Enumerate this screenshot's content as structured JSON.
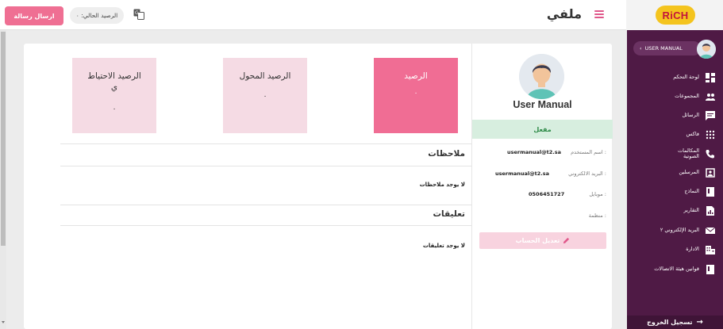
{
  "topbar": {
    "send_button": "ارسال رسالة",
    "balance_label": "الرصيد الحالي: ٠",
    "page_title": "ملفي",
    "logo_text": "RiCH"
  },
  "sidebar": {
    "user_label": "USER MANUAL",
    "items": [
      {
        "label": "لوحة التحكم",
        "icon": "dashboard-icon"
      },
      {
        "label": "المجموعات",
        "icon": "groups-icon"
      },
      {
        "label": "الرسائل",
        "icon": "messages-icon"
      },
      {
        "label": "فاكس",
        "icon": "fax-icon"
      },
      {
        "label": "المكالمات الصوتية",
        "icon": "phone-icon"
      },
      {
        "label": "المرسلين",
        "icon": "senders-icon"
      },
      {
        "label": "النماذج",
        "icon": "templates-icon"
      },
      {
        "label": "التقارير",
        "icon": "reports-icon"
      },
      {
        "label": "البريد الإلكتروني ٢",
        "icon": "mail-icon"
      },
      {
        "label": "الادارة",
        "icon": "admin-icon"
      },
      {
        "label": "قوانين هيئة الاتصالات",
        "icon": "rules-icon"
      }
    ],
    "logout_label": "تسجيل الخروج"
  },
  "profile": {
    "name": "User Manual",
    "status": "مفعل",
    "username_label": "اسم المستخدم :",
    "username_value": "usermanual@t2.sa",
    "email_label": "البريد الالكتروني :",
    "email_value": "usermanual@t2.sa",
    "mobile_label": "موبايل :",
    "mobile_value": "0506451727",
    "org_label": "منظمة :",
    "edit_button": "تعديل الحساب"
  },
  "stats": [
    {
      "title": "الرصيد",
      "value": "٠"
    },
    {
      "title": "الرصيد المحول",
      "value": "٠"
    },
    {
      "title_line1": "الرصيد الاحتياط",
      "title_line2": "ي",
      "value": "٠"
    }
  ],
  "notes": {
    "heading": "ملاحظات",
    "empty": "لا يوجد ملاحظات"
  },
  "comments": {
    "heading": "تعليقات",
    "empty": "لا يوجد تعليقات"
  },
  "colors": {
    "accent_pink": "#f06d94",
    "sidebar_purple": "#4f1a45",
    "status_green": "#2f8b48"
  }
}
